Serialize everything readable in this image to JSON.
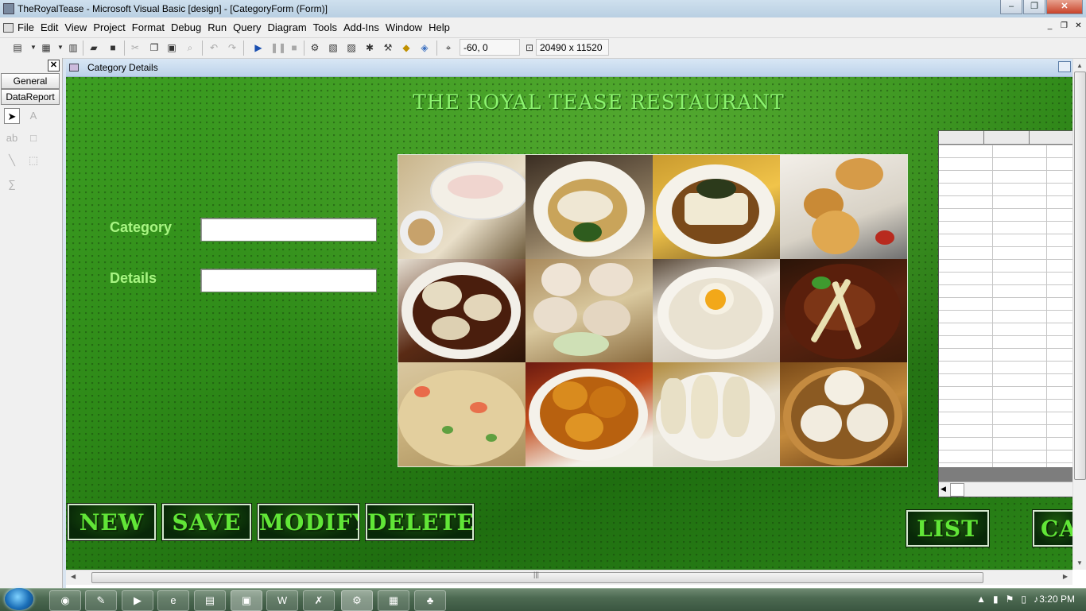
{
  "window": {
    "title": "TheRoyalTease - Microsoft Visual Basic [design] - [CategoryForm (Form)]",
    "controls": [
      "–",
      "❐",
      "✕"
    ]
  },
  "menubar": {
    "items": [
      "File",
      "Edit",
      "View",
      "Project",
      "Format",
      "Debug",
      "Run",
      "Query",
      "Diagram",
      "Tools",
      "Add-Ins",
      "Window",
      "Help"
    ],
    "mdi_controls": [
      "_",
      "❐",
      "✕"
    ]
  },
  "toolbar": {
    "position": "-60, 0",
    "size": "20490 x 11520"
  },
  "toolbox": {
    "close": "✕",
    "tabs": [
      "General",
      "DataReport"
    ]
  },
  "form": {
    "caption": "Category Details",
    "heading": "THE ROYAL TEASE RESTAURANT",
    "category_label": "Category",
    "details_label": "Details",
    "category_value": "",
    "details_value": "",
    "buttons": {
      "new": "NEW",
      "save": "SAVE",
      "modify": "MODIFY",
      "delete": "DELETE",
      "list": "LIST",
      "ca": "CA"
    }
  },
  "taskbar": {
    "clock": "3:20 PM"
  },
  "colors": {
    "form_green": "#2f8c1a",
    "heading_green": "#8cf36f",
    "label_green": "#a8f582",
    "button_text": "#61e637"
  }
}
